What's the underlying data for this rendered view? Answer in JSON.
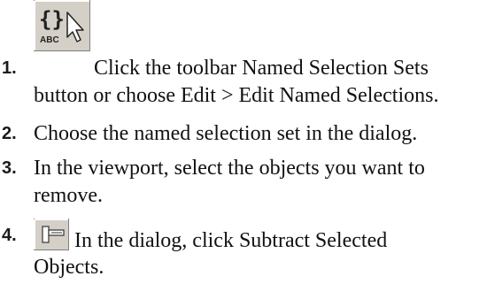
{
  "steps": [
    {
      "number": "1.",
      "icon": "named-selection-sets-icon",
      "line1": "Click the toolbar Named Selection Sets",
      "line2": "button or choose Edit > Edit Named Selections."
    },
    {
      "number": "2.",
      "line1": "Choose the named selection set in the dialog."
    },
    {
      "number": "3.",
      "line1": "In the viewport, select the objects you want to",
      "line2": "remove."
    },
    {
      "number": "4.",
      "icon": "subtract-selected-objects-icon",
      "line1": "In the dialog, click Subtract Selected",
      "line2": "Objects."
    }
  ],
  "icon_labels": {
    "named_selection_abc": "ABC"
  }
}
